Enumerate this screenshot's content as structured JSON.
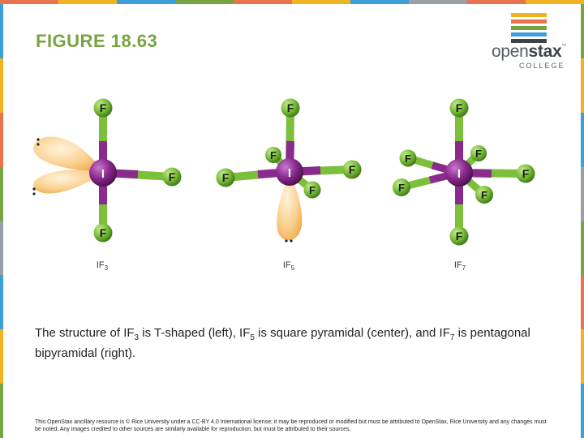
{
  "header": {
    "title": "FIGURE 18.63"
  },
  "logo": {
    "name_light": "open",
    "name_bold": "stax",
    "trademark": "™",
    "subtitle": "COLLEGE",
    "stripe_colors": [
      "#f0b323",
      "#e8744f",
      "#77a342",
      "#3e9fd8",
      "#3e4347"
    ]
  },
  "figure": {
    "molecules": [
      {
        "central_atom": "I",
        "ligands": [
          "F",
          "F",
          "F"
        ],
        "label_base": "IF",
        "label_sub": "3"
      },
      {
        "central_atom": "I",
        "ligands": [
          "F",
          "F",
          "F",
          "F",
          "F"
        ],
        "label_base": "IF",
        "label_sub": "5"
      },
      {
        "central_atom": "I",
        "ligands": [
          "F",
          "F",
          "F",
          "F",
          "F",
          "F",
          "F"
        ],
        "label_base": "IF",
        "label_sub": "7"
      }
    ],
    "colors": {
      "iodine": "#8a2a8f",
      "fluorine": "#7bbf3a",
      "lone_pair": "#f5c06a"
    }
  },
  "caption": {
    "p1": "The structure of IF",
    "s1": "3",
    "p2": " is T-shaped (left), IF",
    "s2": "5",
    "p3": " is square pyramidal (center), and IF",
    "s3": "7",
    "p4": " is pentagonal bipyramidal (right)."
  },
  "footer": {
    "text": "This OpenStax ancillary resource is © Rice University under a CC-BY 4.0 International license; it may be reproduced or modified but must be attributed to OpenStax, Rice University and any changes must be noted. Any images credited to other sources are similarly available for reproduction, but must be attributed to their sources."
  },
  "theme": {
    "top_bar_colors": [
      "#e8744f",
      "#f0b323",
      "#3e9fd8",
      "#77a342",
      "#e8744f",
      "#f0b323",
      "#3e9fd8",
      "#9aa0a6",
      "#e8744f",
      "#f0b323"
    ],
    "edge_colors": [
      "#3e9fd8",
      "#f0b323",
      "#e8744f",
      "#77a342",
      "#9aa0a6",
      "#3e9fd8",
      "#f0b323",
      "#77a342"
    ]
  }
}
